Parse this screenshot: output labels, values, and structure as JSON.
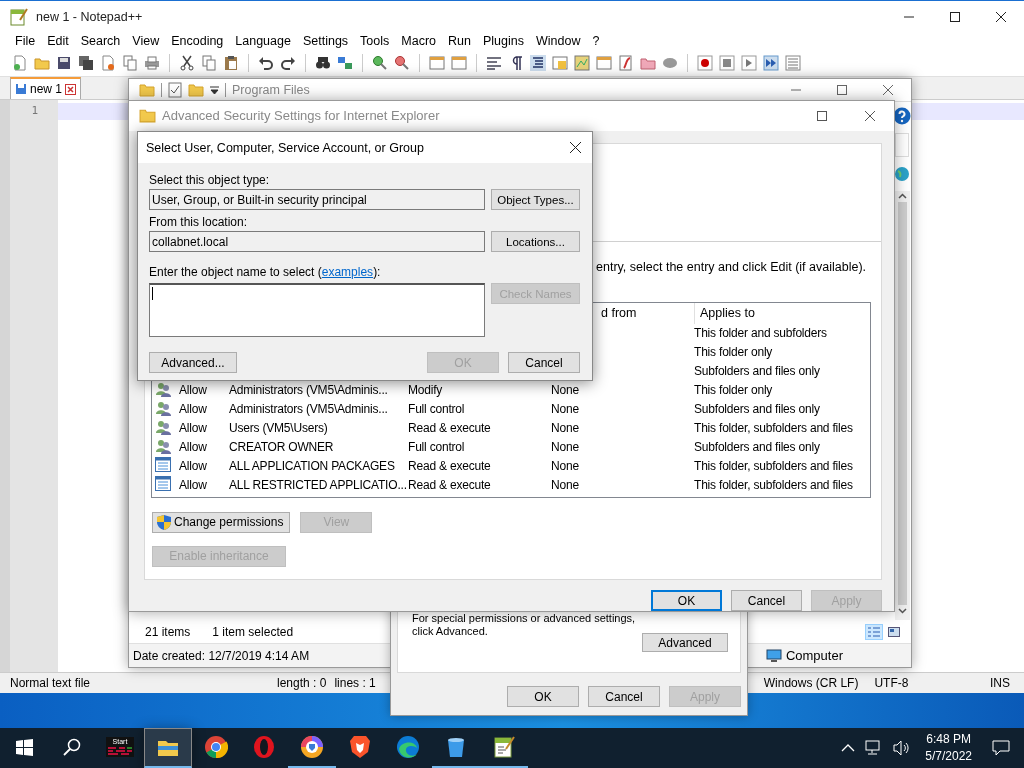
{
  "notepad": {
    "title": "new 1 - Notepad++",
    "menu": [
      "File",
      "Edit",
      "Search",
      "View",
      "Encoding",
      "Language",
      "Settings",
      "Tools",
      "Macro",
      "Run",
      "Plugins",
      "Window",
      "?"
    ],
    "tabs": [
      {
        "label": "new 1",
        "selected": true
      }
    ],
    "line_numbers": [
      "1"
    ],
    "status_bar": {
      "file_type": "Normal text file",
      "length": "length : 0",
      "lines": "lines : 1",
      "eol": "Windows (CR LF)",
      "encoding": "UTF-8",
      "mode": "INS"
    }
  },
  "explorer": {
    "title": "Program Files",
    "item_count": "21 items",
    "selection": "1 item selected",
    "date_created": "Date created: 12/7/2019 4:14 AM",
    "location": "Computer",
    "view_buttons": [
      {
        "kind": "details",
        "selected": true
      },
      {
        "kind": "tiles",
        "selected": false
      }
    ]
  },
  "properties_dialog": {
    "hint": "For special permissions or advanced settings, click Advanced.",
    "advanced_button": "Advanced",
    "buttons": [
      {
        "label": "OK",
        "disabled": false
      },
      {
        "label": "Cancel",
        "disabled": false
      },
      {
        "label": "Apply",
        "disabled": true
      }
    ]
  },
  "advanced_security": {
    "title": "Advanced Security Settings for Internet Explorer",
    "instruction": "entry, select the entry and click Edit (if available).",
    "columns": {
      "inherited": "d from",
      "applies_to": "Applies to"
    },
    "rows": [
      {
        "applies_to": "This folder and subfolders"
      },
      {
        "applies_to": "This folder only"
      },
      {
        "applies_to": "Subfolders and files only"
      },
      {
        "kind": "user",
        "type": "Allow",
        "principal": "Administrators (VM5\\Adminis...",
        "access": "Modify",
        "inherited": "None",
        "applies_to": "This folder only"
      },
      {
        "kind": "user",
        "type": "Allow",
        "principal": "Administrators (VM5\\Adminis...",
        "access": "Full control",
        "inherited": "None",
        "applies_to": "Subfolders and files only"
      },
      {
        "kind": "user",
        "type": "Allow",
        "principal": "Users (VM5\\Users)",
        "access": "Read & execute",
        "inherited": "None",
        "applies_to": "This folder, subfolders and files"
      },
      {
        "kind": "user",
        "type": "Allow",
        "principal": "CREATOR OWNER",
        "access": "Full control",
        "inherited": "None",
        "applies_to": "Subfolders and files only"
      },
      {
        "kind": "package",
        "type": "Allow",
        "principal": "ALL APPLICATION PACKAGES",
        "access": "Read & execute",
        "inherited": "None",
        "applies_to": "This folder, subfolders and files"
      },
      {
        "kind": "package",
        "type": "Allow",
        "principal": "ALL RESTRICTED APPLICATIO...",
        "access": "Read & execute",
        "inherited": "None",
        "applies_to": "This folder, subfolders and files"
      }
    ],
    "change_permissions": {
      "label": "Change permissions",
      "disabled": false
    },
    "view": {
      "label": "View",
      "disabled": true
    },
    "enable_inheritance": {
      "label": "Enable inheritance",
      "disabled": true
    },
    "buttons": [
      {
        "label": "OK",
        "disabled": false,
        "default": true
      },
      {
        "label": "Cancel",
        "disabled": false,
        "default": false
      },
      {
        "label": "Apply",
        "disabled": true,
        "default": false
      }
    ]
  },
  "select_dialog": {
    "title": "Select User, Computer, Service Account, or Group",
    "object_type_label": "Select this object type:",
    "object_type_value": "User, Group, or Built-in security principal",
    "object_types_button": "Object Types...",
    "location_label": "From this location:",
    "location_value": "collabnet.local",
    "locations_button": "Locations...",
    "name_prompt": {
      "before": "Enter the object name to select (",
      "link": "examples",
      "after": "):"
    },
    "check_names": {
      "label": "Check Names",
      "disabled": true
    },
    "advanced_button": "Advanced...",
    "buttons": [
      {
        "label": "OK",
        "disabled": true
      },
      {
        "label": "Cancel",
        "disabled": false
      }
    ]
  },
  "taskbar": {
    "apps": [
      {
        "kind": "start-tile",
        "label": "Start",
        "running": false,
        "selected": false
      },
      {
        "kind": "folder",
        "running": true,
        "selected": true
      },
      {
        "kind": "chrome",
        "running": false,
        "selected": false
      },
      {
        "kind": "opera",
        "running": false,
        "selected": false
      },
      {
        "kind": "shield-browser",
        "running": true,
        "selected": false
      },
      {
        "kind": "brave",
        "running": false,
        "selected": false
      },
      {
        "kind": "edge",
        "running": false,
        "selected": false
      },
      {
        "kind": "bucket",
        "running": true,
        "selected": false
      },
      {
        "kind": "notepad",
        "running": true,
        "selected": false
      }
    ],
    "time": "6:48 PM",
    "date": "5/7/2022"
  }
}
